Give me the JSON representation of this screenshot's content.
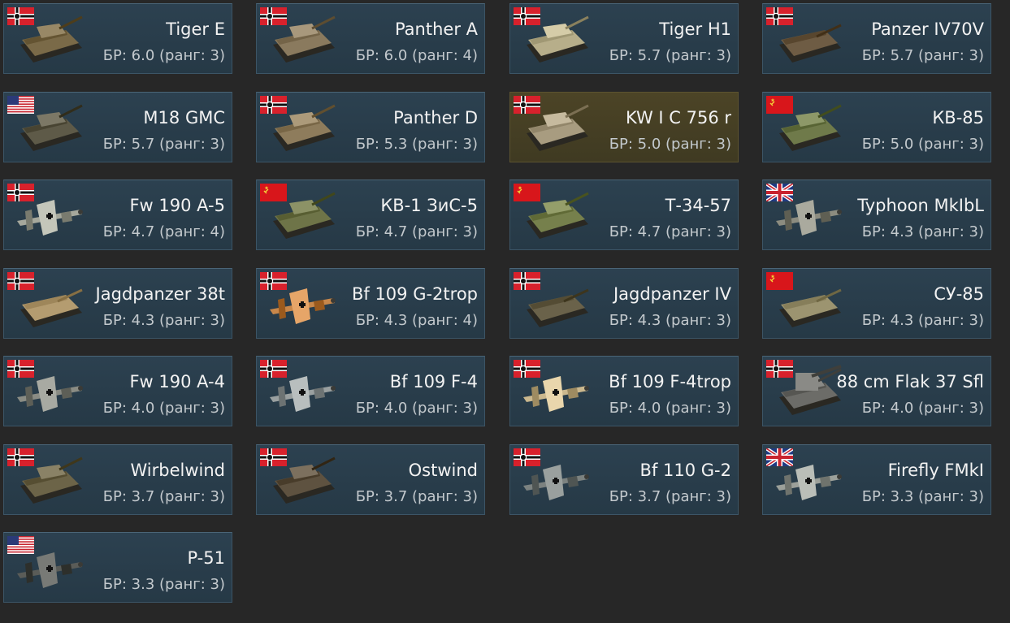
{
  "br_prefix": "БР:",
  "rank_prefix": "ранг:",
  "vehicles": [
    {
      "name": "Tiger E",
      "br": "6.0",
      "rank": "3",
      "nation": "germany",
      "kind": "tank",
      "camo": "#7a6a48",
      "selected": false
    },
    {
      "name": "Panther A",
      "br": "6.0",
      "rank": "4",
      "nation": "germany",
      "kind": "tank",
      "camo": "#8a7a5e",
      "selected": false
    },
    {
      "name": "Tiger H1",
      "br": "5.7",
      "rank": "3",
      "nation": "germany",
      "kind": "tank",
      "camo": "#b7ae8a",
      "selected": false
    },
    {
      "name": "Panzer IV70V",
      "br": "5.7",
      "rank": "3",
      "nation": "germany",
      "kind": "spg",
      "camo": "#6e5c44",
      "selected": false
    },
    {
      "name": "M18 GMC",
      "br": "5.7",
      "rank": "3",
      "nation": "usa",
      "kind": "tank",
      "camo": "#5e5a48",
      "selected": false
    },
    {
      "name": "Panther D",
      "br": "5.3",
      "rank": "3",
      "nation": "germany",
      "kind": "tank",
      "camo": "#8e7c5c",
      "selected": false
    },
    {
      "name": "KW I C 756 r",
      "br": "5.0",
      "rank": "3",
      "nation": "germany",
      "kind": "tank",
      "camo": "#a89c80",
      "selected": true
    },
    {
      "name": "КВ-85",
      "br": "5.0",
      "rank": "3",
      "nation": "ussr",
      "kind": "tank",
      "camo": "#6f7a4a",
      "selected": false
    },
    {
      "name": "Fw 190 A-5",
      "br": "4.7",
      "rank": "4",
      "nation": "germany",
      "kind": "plane",
      "camo": "#a6a89c",
      "selected": false
    },
    {
      "name": "КВ-1 ЗиС-5",
      "br": "4.7",
      "rank": "3",
      "nation": "ussr",
      "kind": "tank",
      "camo": "#6e7448",
      "selected": false
    },
    {
      "name": "Т-34-57",
      "br": "4.7",
      "rank": "3",
      "nation": "ussr",
      "kind": "tank",
      "camo": "#76804c",
      "selected": false
    },
    {
      "name": "Typhoon MkIbL",
      "br": "4.3",
      "rank": "3",
      "nation": "uk",
      "kind": "plane",
      "camo": "#8c8c80",
      "selected": false
    },
    {
      "name": "Jagdpanzer 38t",
      "br": "4.3",
      "rank": "3",
      "nation": "germany",
      "kind": "spg",
      "camo": "#b49c70",
      "selected": false
    },
    {
      "name": "Bf 109 G-2trop",
      "br": "4.3",
      "rank": "4",
      "nation": "germany",
      "kind": "plane",
      "camo": "#c8874a",
      "selected": false
    },
    {
      "name": "Jagdpanzer IV",
      "br": "4.3",
      "rank": "3",
      "nation": "germany",
      "kind": "spg",
      "camo": "#6a624a",
      "selected": false
    },
    {
      "name": "СУ-85",
      "br": "4.3",
      "rank": "3",
      "nation": "ussr",
      "kind": "spg",
      "camo": "#9c9470",
      "selected": false
    },
    {
      "name": "Fw 190 A-4",
      "br": "4.0",
      "rank": "3",
      "nation": "germany",
      "kind": "plane",
      "camo": "#8a8c84",
      "selected": false
    },
    {
      "name": "Bf 109 F-4",
      "br": "4.0",
      "rank": "3",
      "nation": "germany",
      "kind": "plane",
      "camo": "#9aa0a0",
      "selected": false
    },
    {
      "name": "Bf 109 F-4trop",
      "br": "4.0",
      "rank": "3",
      "nation": "germany",
      "kind": "plane",
      "camo": "#cbb88e",
      "selected": false
    },
    {
      "name": "88 cm Flak 37 Sfl",
      "br": "4.0",
      "rank": "3",
      "nation": "germany",
      "kind": "aa",
      "camo": "#6c6c68",
      "selected": false
    },
    {
      "name": "Wirbelwind",
      "br": "3.7",
      "rank": "3",
      "nation": "germany",
      "kind": "tank",
      "camo": "#6c6448",
      "selected": false
    },
    {
      "name": "Ostwind",
      "br": "3.7",
      "rank": "3",
      "nation": "germany",
      "kind": "tank",
      "camo": "#5e5240",
      "selected": false
    },
    {
      "name": "Bf 110 G-2",
      "br": "3.7",
      "rank": "3",
      "nation": "germany",
      "kind": "plane",
      "camo": "#7c8280",
      "selected": false
    },
    {
      "name": "Firefly FMkI",
      "br": "3.3",
      "rank": "3",
      "nation": "uk",
      "kind": "plane",
      "camo": "#9ca09a",
      "selected": false
    },
    {
      "name": "P-51",
      "br": "3.3",
      "rank": "3",
      "nation": "usa",
      "kind": "plane",
      "camo": "#5a5c58",
      "selected": false
    }
  ]
}
